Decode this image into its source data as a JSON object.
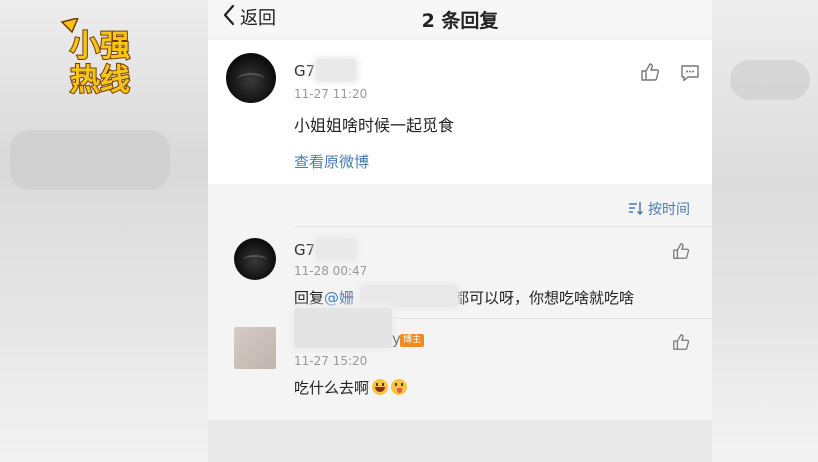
{
  "logo": {
    "line1": "小强",
    "line2": "热线"
  },
  "nav": {
    "back_label": "返回",
    "title": "2 条回复"
  },
  "post": {
    "username": "G7",
    "time": "11-27 11:20",
    "content": "小姐姐啥时候一起觅食",
    "view_original": "查看原微博"
  },
  "sort": {
    "label": "按时间"
  },
  "replies": [
    {
      "username": "G7",
      "time": "11-28 00:47",
      "reply_prefix": "回复",
      "mention": "@姗",
      "content": "都可以呀，你想吃啥就吃啥"
    },
    {
      "username_tail": "y",
      "badge": "博主",
      "time": "11-27 15:20",
      "content": "吃什么去啊"
    }
  ],
  "colors": {
    "link": "#4a7cb7",
    "badge": "#f08b1e"
  }
}
